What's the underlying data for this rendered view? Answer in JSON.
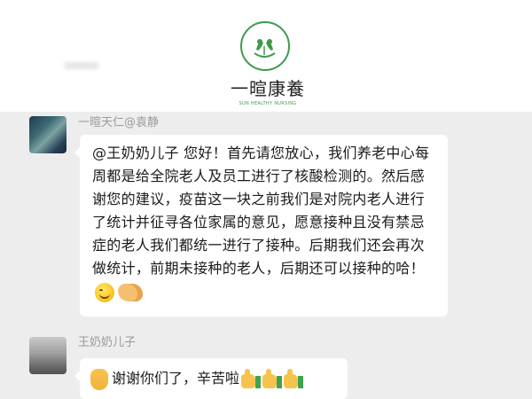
{
  "header": {
    "brand_name": "一暄康養",
    "brand_sub": "SUN HEALTHY NURSING",
    "logo_color": "#3f9a4c"
  },
  "messages": [
    {
      "sender": "一暄天仁@袁静",
      "text": "@王奶奶儿子 您好！首先请您放心，我们养老中心每周都是给全院老人及员工进行了核酸检测的。然后感谢您的建议，疫苗这一块之前我们是对院内老人进行了统计并征寻各位家属的意见，愿意接种且没有禁忌症的老人我们都统一进行了接种。后期我们还会再次做统计，前期未接种的老人，后期还可以接种的哈！",
      "emojis": [
        "smile-icon",
        "handshake-icon"
      ]
    },
    {
      "sender": "王奶奶儿子",
      "text": "谢谢你们了，辛苦啦",
      "emojis": [
        "victory-hand-icon",
        "thumbs-up-icon",
        "thumbs-up-icon",
        "thumbs-up-icon"
      ]
    }
  ],
  "colors": {
    "chat_background": "#ededed",
    "bubble": "#ffffff",
    "sender_name": "#9a9a9a"
  }
}
